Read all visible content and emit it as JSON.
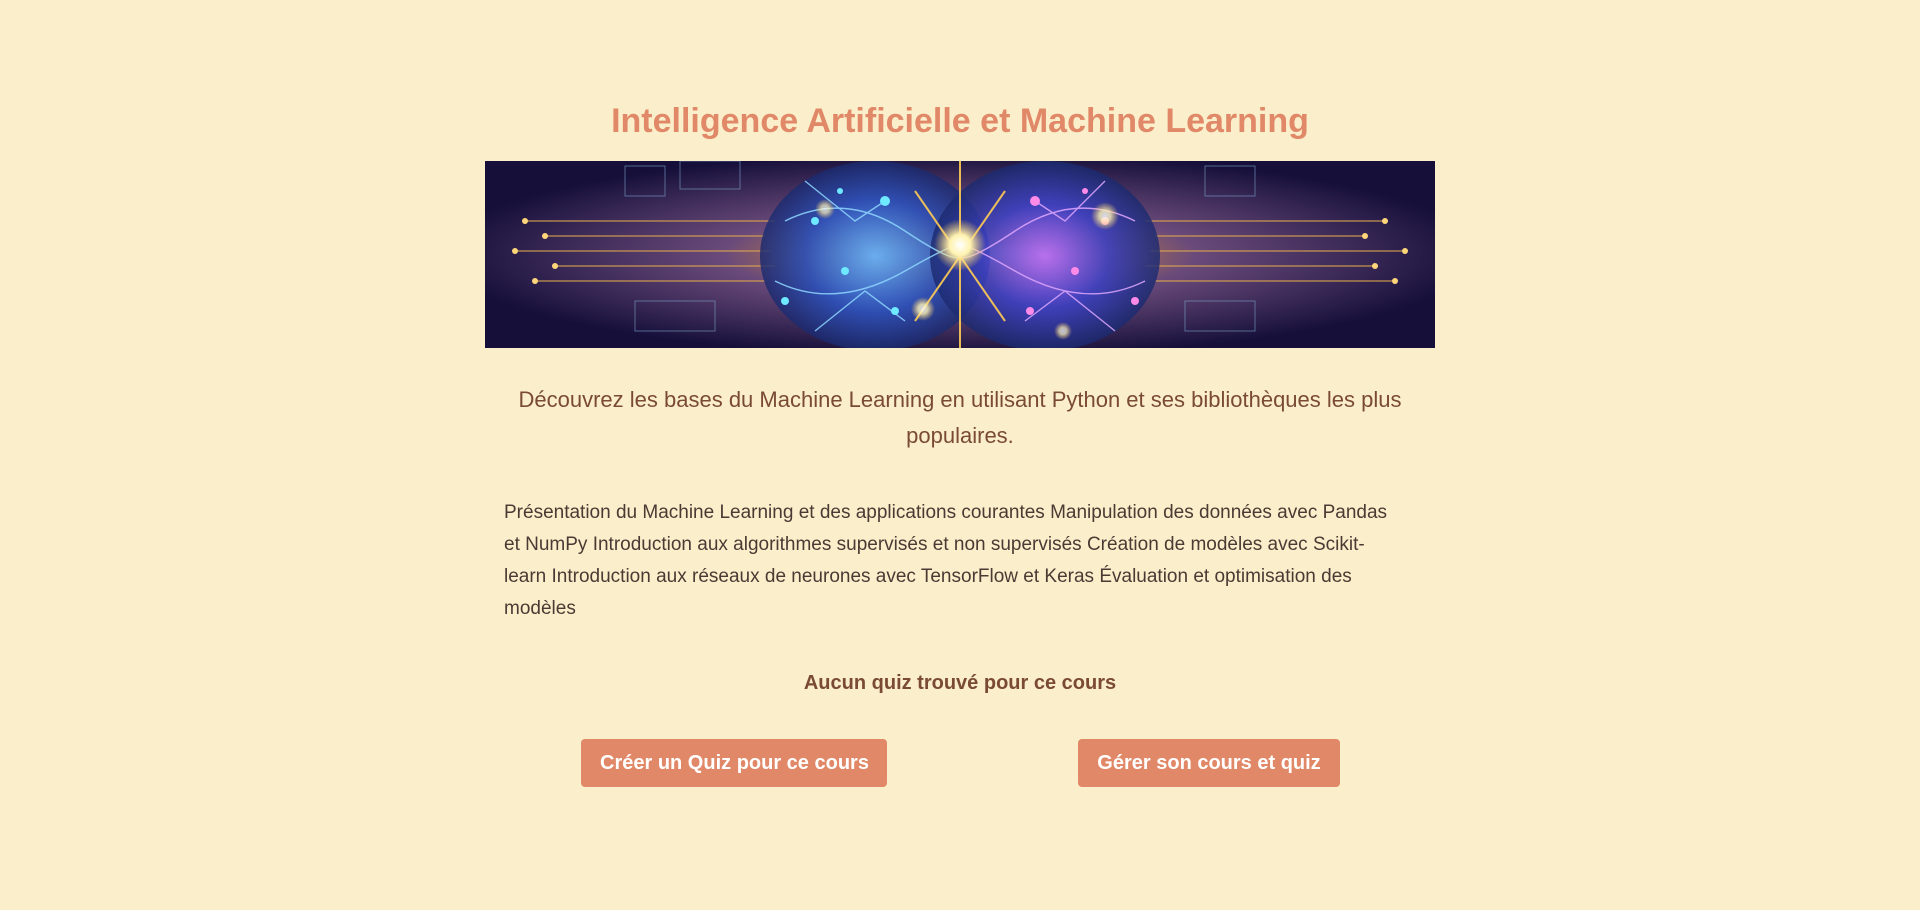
{
  "course": {
    "title": "Intelligence Artificielle et Machine Learning",
    "subtitle": "Découvrez les bases du Machine Learning en utilisant Python et ses bibliothèques les plus populaires.",
    "description": "Présentation du Machine Learning et des applications courantes Manipulation des données avec Pandas et NumPy Introduction aux algorithmes supervisés et non supervisés Création de modèles avec Scikit-learn Introduction aux réseaux de neurones avec TensorFlow et Keras Évaluation et optimisation des modèles",
    "banner_alt": "AI brain circuit illustration"
  },
  "quiz": {
    "empty_message": "Aucun quiz trouvé pour ce cours"
  },
  "actions": {
    "create_quiz_label": "Créer un Quiz pour ce cours",
    "manage_course_label": "Gérer son cours et quiz"
  },
  "colors": {
    "background": "#fbefcb",
    "accent": "#e08867",
    "text_brown": "#7a4a35",
    "text_dark": "#4a3a34"
  }
}
